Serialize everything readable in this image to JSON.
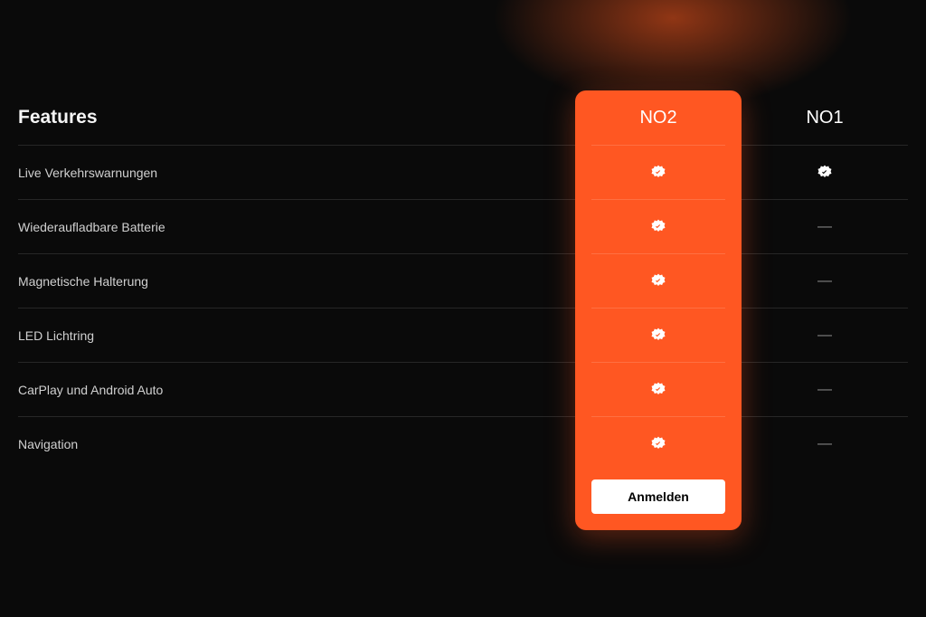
{
  "table": {
    "title": "Features",
    "columns": {
      "highlight": "NO2",
      "other": "NO1"
    },
    "rows": [
      {
        "label": "Live Verkehrswarnungen",
        "highlight": true,
        "other": true
      },
      {
        "label": "Wiederaufladbare Batterie",
        "highlight": true,
        "other": false
      },
      {
        "label": "Magnetische Halterung",
        "highlight": true,
        "other": false
      },
      {
        "label": "LED Lichtring",
        "highlight": true,
        "other": false
      },
      {
        "label": "CarPlay und Android Auto",
        "highlight": true,
        "other": false
      },
      {
        "label": "Navigation",
        "highlight": true,
        "other": false
      }
    ],
    "cta": "Anmelden"
  }
}
